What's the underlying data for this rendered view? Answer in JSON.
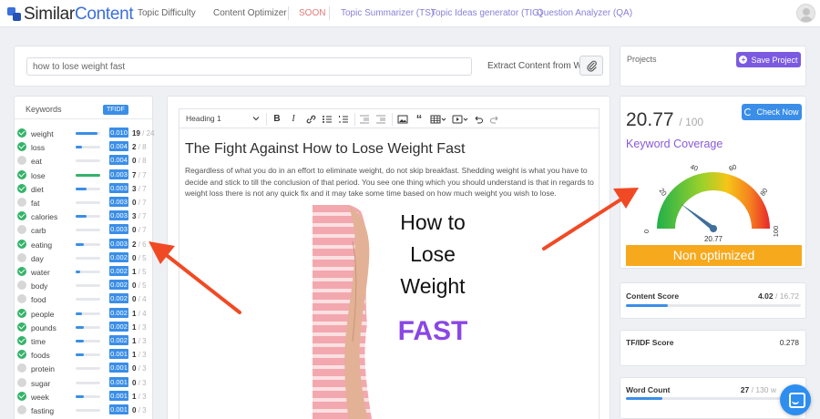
{
  "app": {
    "logo_prefix": "Similar",
    "logo_suffix": "Content",
    "nav": [
      {
        "label": "Topic Difficulty"
      },
      {
        "label": "Content Optimizer"
      },
      {
        "label": "SOON"
      },
      {
        "label": "Topic Summarizer (TS)"
      },
      {
        "label": "Topic Ideas generator (TIG)"
      },
      {
        "label": "Question Analyzer (QA)"
      }
    ]
  },
  "search": {
    "value": "how to lose weight fast",
    "extract_label": "Extract Content from Web"
  },
  "projects": {
    "label": "Projects",
    "save_label": "Save Project"
  },
  "keywords": {
    "title": "Keywords",
    "badge": "TFIDF",
    "rows": [
      {
        "term": "weight",
        "score": "0.010",
        "count": "19",
        "target": "/ 24",
        "checked": true,
        "level": 0.9
      },
      {
        "term": "loss",
        "score": "0.004",
        "count": "2",
        "target": "/ 8",
        "checked": true,
        "level": 0.25
      },
      {
        "term": "eat",
        "score": "0.004",
        "count": "0",
        "target": "/ 8",
        "checked": false,
        "level": 0
      },
      {
        "term": "lose",
        "score": "0.003",
        "count": "7",
        "target": "/ 7",
        "checked": true,
        "level": 1.0
      },
      {
        "term": "diet",
        "score": "0.003",
        "count": "3",
        "target": "/ 7",
        "checked": true,
        "level": 0.43
      },
      {
        "term": "fat",
        "score": "0.003",
        "count": "0",
        "target": "/ 7",
        "checked": false,
        "level": 0
      },
      {
        "term": "calories",
        "score": "0.003",
        "count": "3",
        "target": "/ 7",
        "checked": true,
        "level": 0.43
      },
      {
        "term": "carb",
        "score": "0.003",
        "count": "0",
        "target": "/ 7",
        "checked": false,
        "level": 0
      },
      {
        "term": "eating",
        "score": "0.003",
        "count": "2",
        "target": "/ 6",
        "checked": true,
        "level": 0.33
      },
      {
        "term": "day",
        "score": "0.002",
        "count": "0",
        "target": "/ 5",
        "checked": false,
        "level": 0
      },
      {
        "term": "water",
        "score": "0.002",
        "count": "1",
        "target": "/ 5",
        "checked": true,
        "level": 0.2
      },
      {
        "term": "body",
        "score": "0.002",
        "count": "0",
        "target": "/ 5",
        "checked": false,
        "level": 0
      },
      {
        "term": "food",
        "score": "0.002",
        "count": "0",
        "target": "/ 4",
        "checked": false,
        "level": 0
      },
      {
        "term": "people",
        "score": "0.002",
        "count": "1",
        "target": "/ 4",
        "checked": true,
        "level": 0.25
      },
      {
        "term": "pounds",
        "score": "0.002",
        "count": "1",
        "target": "/ 3",
        "checked": true,
        "level": 0.33
      },
      {
        "term": "time",
        "score": "0.002",
        "count": "1",
        "target": "/ 3",
        "checked": true,
        "level": 0.33
      },
      {
        "term": "foods",
        "score": "0.001",
        "count": "1",
        "target": "/ 3",
        "checked": true,
        "level": 0.33
      },
      {
        "term": "protein",
        "score": "0.001",
        "count": "0",
        "target": "/ 3",
        "checked": false,
        "level": 0
      },
      {
        "term": "sugar",
        "score": "0.001",
        "count": "0",
        "target": "/ 3",
        "checked": false,
        "level": 0
      },
      {
        "term": "week",
        "score": "0.001",
        "count": "1",
        "target": "/ 3",
        "checked": true,
        "level": 0.33
      },
      {
        "term": "fasting",
        "score": "0.001",
        "count": "0",
        "target": "/ 3",
        "checked": false,
        "level": 0
      }
    ]
  },
  "editor": {
    "heading_select": "Heading 1",
    "doc_title": "The Fight Against How to Lose Weight Fast",
    "doc_body": "Regardless of what you do in an effort to eliminate weight, do not skip breakfast. Shedding weight is what you have to decide and stick to till the conclusion of that period. You see one thing which you should understand is that in regards to weight loss there is not any quick fix and it may take some time based on how much weight you wish to lose.",
    "image_lines": [
      "How to",
      "Lose",
      "Weight"
    ],
    "image_accent": "FAST"
  },
  "score": {
    "value": "20.77",
    "max": "/ 100",
    "check_label": "Check Now",
    "coverage_label": "Keyword Coverage",
    "gauge_ticks": [
      "0",
      "20",
      "40",
      "60",
      "80",
      "100"
    ],
    "gauge_value": 20.77,
    "gauge_readout": "20.77",
    "status": "Non optimized"
  },
  "metrics": {
    "content_score": {
      "label": "Content Score",
      "value": "4.02",
      "max": "/ 16.72",
      "level": 0.24
    },
    "tfidf_score": {
      "label": "TF/IDF Score",
      "value": "0.278"
    },
    "word_count": {
      "label": "Word Count",
      "value": "27",
      "max": "/ 130 w",
      "level": 0.21
    }
  },
  "colors": {
    "accent_blue": "#3a8ee8",
    "brand_purple": "#7b5ae0",
    "status_orange": "#f6a91d",
    "arrow_red": "#f04a24",
    "check_green": "#34b36a"
  }
}
